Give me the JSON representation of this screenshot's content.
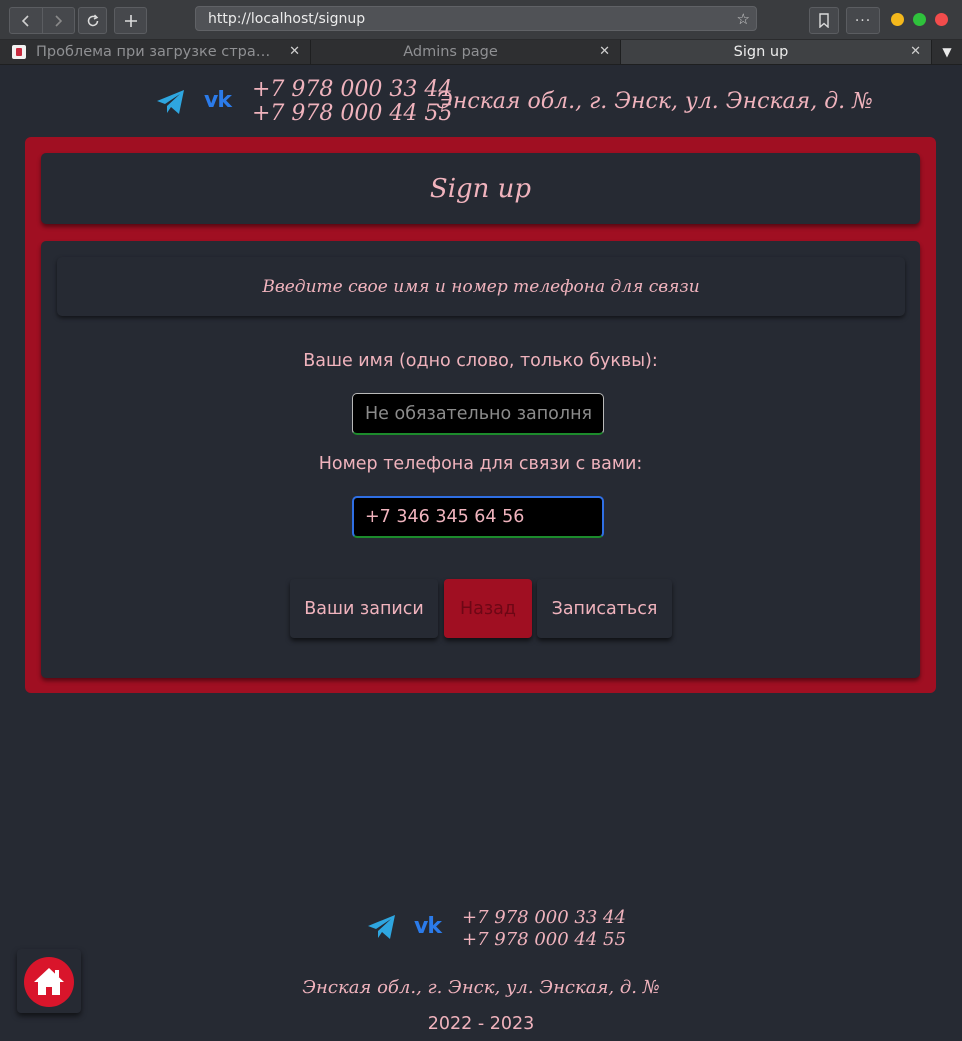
{
  "browser": {
    "url": "http://localhost/signup",
    "tabs": [
      {
        "label": "Проблема при загрузке стра…",
        "active": false
      },
      {
        "label": "Admins page",
        "active": false
      },
      {
        "label": "Sign up",
        "active": true
      }
    ],
    "close_glyph": "✕",
    "traffic_colors": [
      "#f4b81c",
      "#2fc23c",
      "#f24c4c"
    ]
  },
  "header": {
    "phone_1": "+7 978 000 33 44",
    "phone_2": "+7 978 000 44 55",
    "address": "Энская обл., г. Энск, ул. Энская, д. №",
    "icons": [
      "telegram-icon",
      "vk-icon"
    ]
  },
  "main": {
    "title": "Sign up",
    "subtitle": "Введите свое имя и номер телефона для связи",
    "name_label": "Ваше имя (одно слово, только буквы):",
    "name_placeholder": "Не обязательно заполнять",
    "name_value": "",
    "phone_label": "Номер телефона для связи с вами:",
    "phone_value": "+7 346 345 64 56",
    "buttons": {
      "my_bookings": "Ваши записи",
      "back": "Назад",
      "sign_up": "Записаться"
    }
  },
  "footer": {
    "phone_1": "+7 978 000 33 44",
    "phone_2": "+7 978 000 44 55",
    "address": "Энская обл., г. Энск, ул. Энская, д. №",
    "years": "2022 - 2023",
    "home_icon": "home-icon"
  },
  "colors": {
    "accent_red": "#a00f22",
    "page_bg": "#262a33",
    "text_pink": "#f0b3bd",
    "telegram_blue": "#2ea6e0",
    "vk_blue": "#2b7bea"
  }
}
